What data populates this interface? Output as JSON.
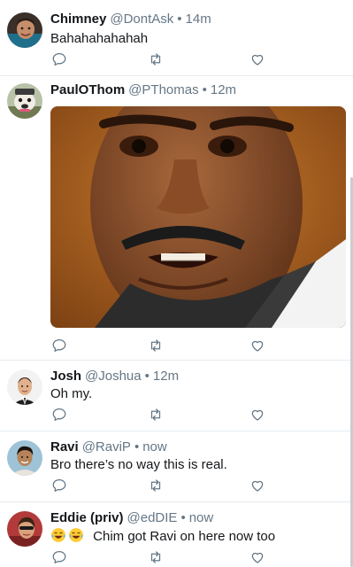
{
  "tweets": [
    {
      "name": "Chimney",
      "handle": "@DontAsk",
      "separator": "•",
      "time": "14m",
      "text": "Bahahahahahah"
    },
    {
      "name": "PaulOThom",
      "handle": "@PThomas",
      "separator": "•",
      "time": "12m",
      "text": ""
    },
    {
      "name": "Josh",
      "handle": "@Joshua",
      "separator": "•",
      "time": "12m",
      "text": "Oh my."
    },
    {
      "name": "Ravi",
      "handle": "@RaviP",
      "separator": "•",
      "time": "now",
      "text": "Bro there’s no way this is real."
    },
    {
      "name": "Eddie (priv)",
      "handle": "@edDIE",
      "separator": "•",
      "time": "now",
      "text": "Chim got Ravi on here now too"
    }
  ],
  "icons": {
    "reply": "reply-icon",
    "retweet": "retweet-icon",
    "like": "heart-icon",
    "emoji": "laughing-tears-emoji-icon"
  },
  "colors": {
    "icon_gray": "#657786",
    "text_dark": "#14171a",
    "divider": "#e6ecf0"
  }
}
